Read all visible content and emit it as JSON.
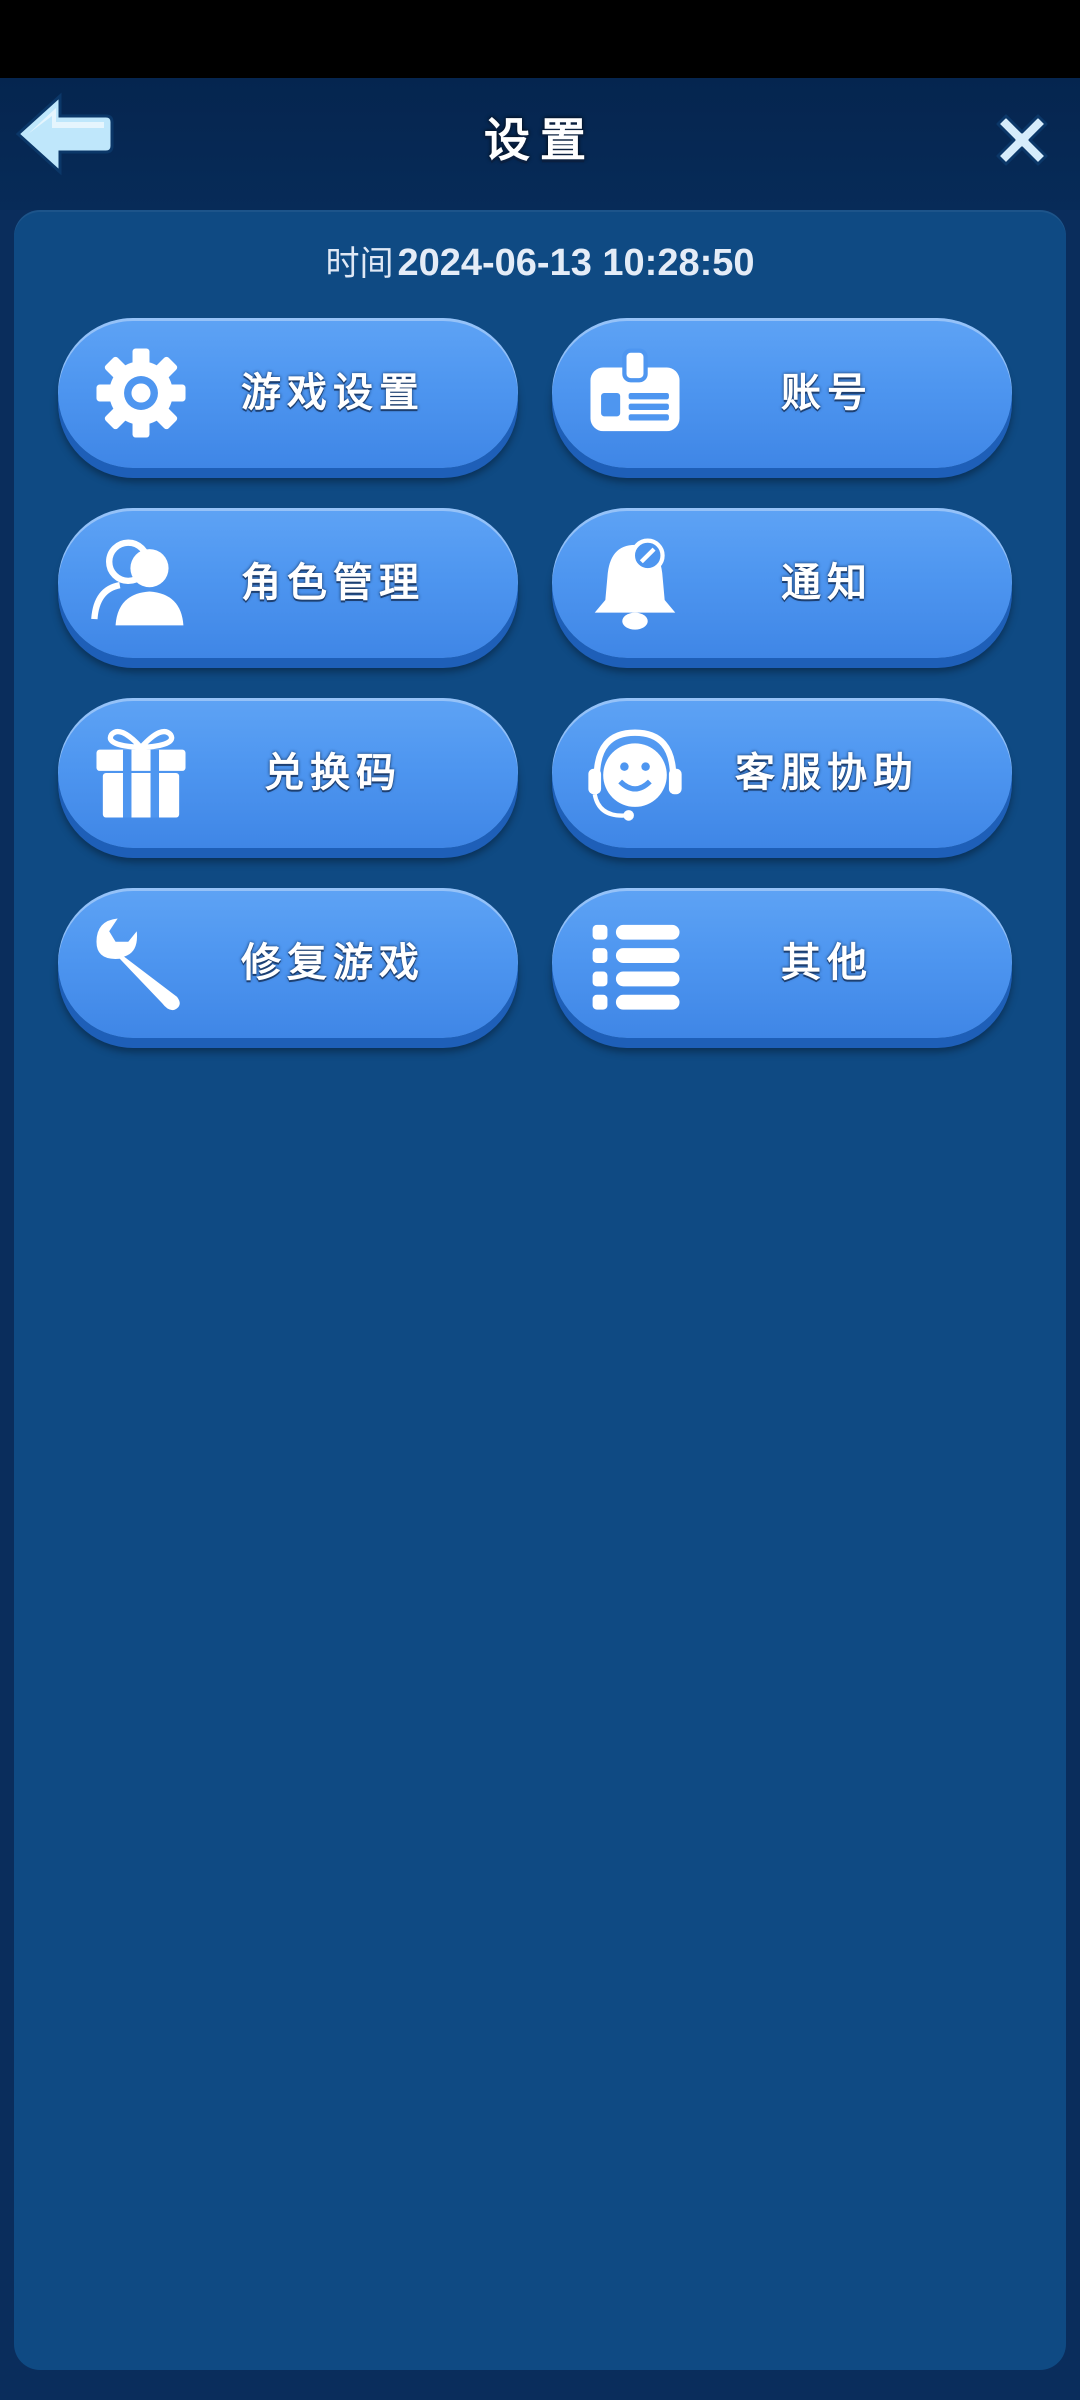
{
  "header": {
    "title": "设置",
    "back_icon": "back-arrow-icon",
    "close_icon": "close-icon"
  },
  "time": {
    "label": "时间",
    "value": "2024-06-13 10:28:50"
  },
  "menu": [
    {
      "label": "游戏设置",
      "icon": "gear-icon"
    },
    {
      "label": "账号",
      "icon": "id-card-icon"
    },
    {
      "label": "角色管理",
      "icon": "users-icon"
    },
    {
      "label": "通知",
      "icon": "bell-icon"
    },
    {
      "label": "兑换码",
      "icon": "gift-icon"
    },
    {
      "label": "客服协助",
      "icon": "headset-icon"
    },
    {
      "label": "修复游戏",
      "icon": "wrench-icon"
    },
    {
      "label": "其他",
      "icon": "list-icon"
    }
  ],
  "colors": {
    "background": "#0a2d5c",
    "panel": "#0f4a83",
    "button": "#4e96f0",
    "button_shadow": "#1e5fb8"
  }
}
